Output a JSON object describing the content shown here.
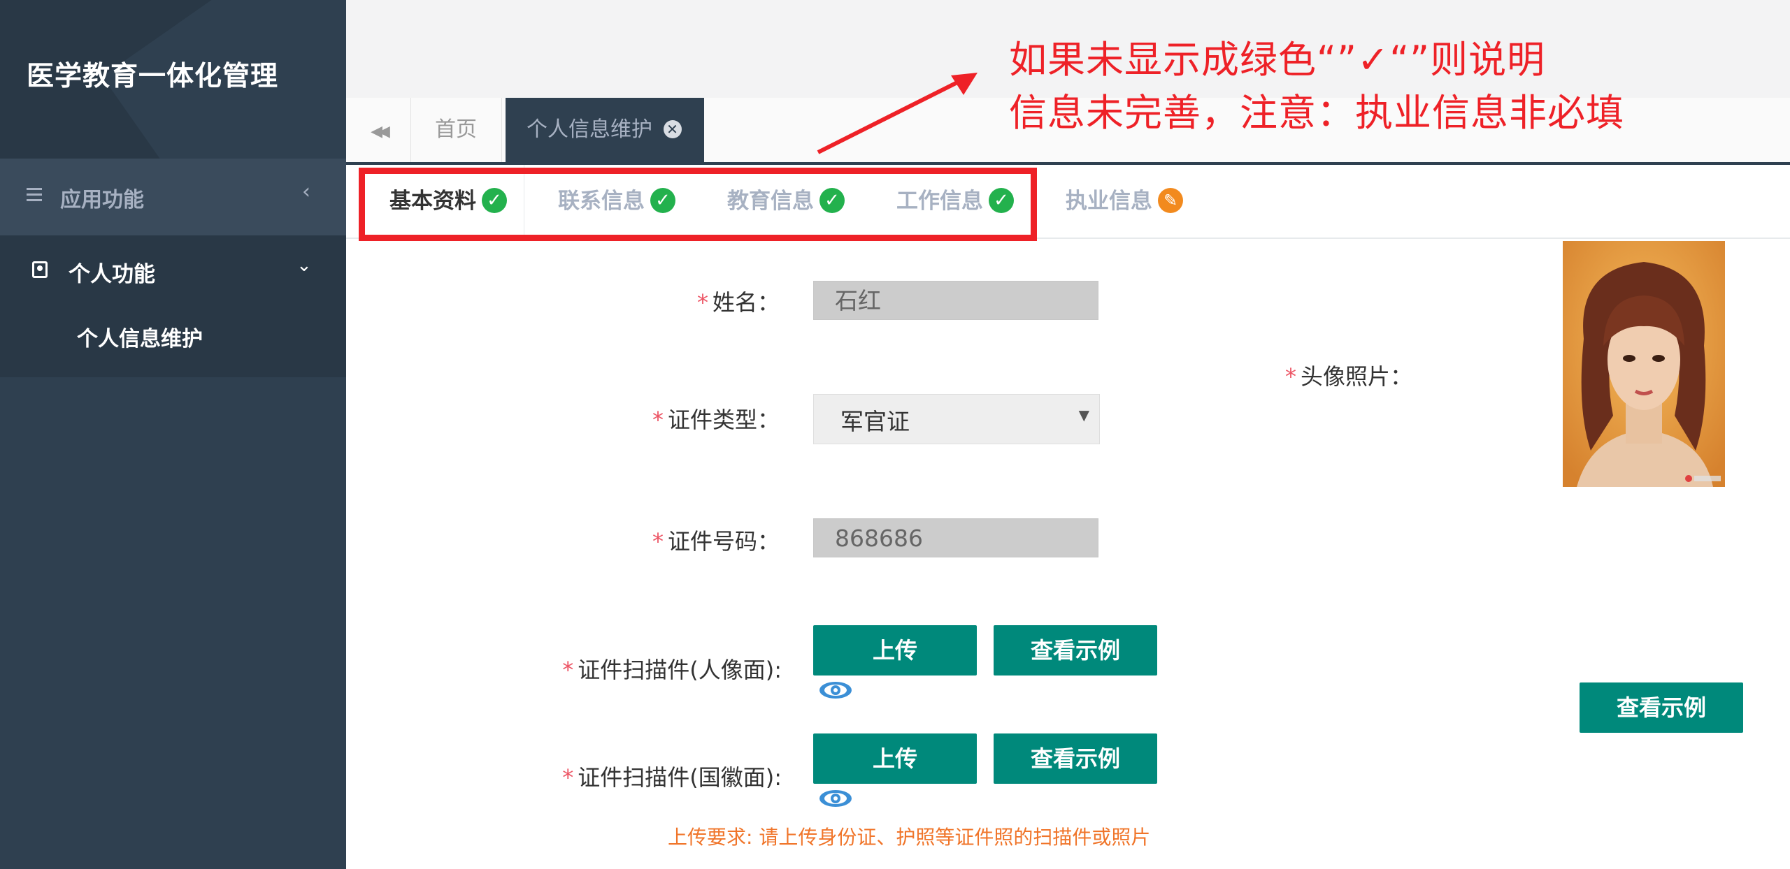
{
  "app": {
    "title": "医学教育一体化管理"
  },
  "sidebar": {
    "app_menu_label": "应用功能",
    "app_menu_chevron": "‹",
    "personal_menu_label": "个人功能",
    "personal_menu_chevron": "⌄",
    "personal_sub_item": "个人信息维护"
  },
  "tabs": {
    "back_icon": "◀◀",
    "home_label": "首页",
    "active_label": "个人信息维护",
    "close_glyph": "✕"
  },
  "subtabs": [
    {
      "label": "基本资料",
      "status": "complete",
      "glyph": "✓"
    },
    {
      "label": "联系信息",
      "status": "complete",
      "glyph": "✓"
    },
    {
      "label": "教育信息",
      "status": "complete",
      "glyph": "✓"
    },
    {
      "label": "工作信息",
      "status": "complete",
      "glyph": "✓"
    },
    {
      "label": "执业信息",
      "status": "incomplete",
      "glyph": "✎"
    }
  ],
  "form": {
    "required_mark": "*",
    "name_label": "姓名：",
    "name_value": "石红",
    "id_type_label": "证件类型：",
    "id_type_value": "军官证",
    "id_type_arrow": "▼",
    "id_number_label": "证件号码：",
    "id_number_value": "868686",
    "scan_front_label": "证件扫描件(人像面):",
    "scan_back_label": "证件扫描件(国徽面):",
    "upload_label": "上传",
    "view_example_label": "查看示例",
    "upload_hint": "上传要求: 请上传身份证、护照等证件照的扫描件或照片",
    "avatar_label": "头像照片：",
    "avatar_view_example_label": "查看示例"
  },
  "annotation": {
    "line1": "如果未显示成绿色“”✓“”则说明",
    "line2": "信息未完善，注意：执业信息非必填"
  },
  "colors": {
    "sidebar_bg": "#2f4050",
    "accent_green": "#00897b",
    "check_green": "#23b14d",
    "warning_orange": "#f28a1e",
    "annotation_red": "#ee2127"
  }
}
